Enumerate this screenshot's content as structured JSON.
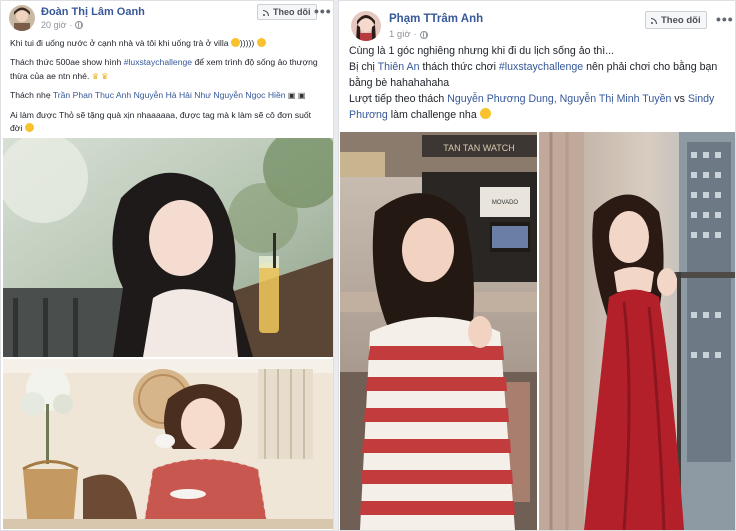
{
  "post1": {
    "author": "Đoàn Thị Lâm Oanh",
    "time": "20 giờ",
    "follow_label": "Theo dõi",
    "more_label": "•••",
    "paragraphs": [
      {
        "pre": "Khi tui đi uống nước ở cạnh nhà và tôi khi uống trà ở villa ",
        "post": ")))))"
      },
      {
        "pre": "Thách thức 500ae show hình ",
        "tag": "#luxstaychallenge",
        "post": " để xem trình độ sống ảo thượng thừa của ae ntn nhé."
      },
      {
        "pre": "Thách nhẹ ",
        "tag": "Trần Phan Thục Anh Nguyễn Hà Hải Như Nguyễn Ngọc Hiền"
      },
      {
        "pre": "Ai làm được Thỏ sẽ tặng quà xịn nhaaaaaa, được tag mà k làm sẽ cô đơn suốt đời"
      }
    ]
  },
  "post2": {
    "author": "Phạm TTrâm Anh",
    "time": "1 giờ",
    "follow_label": "Theo dõi",
    "more_label": "•••",
    "line1": "Cùng là 1 góc nghiêng nhưng khi đi du lịch sống ảo thì...",
    "line2_pre": "Bị chị ",
    "line2_tag1": "Thiên An",
    "line2_mid": " thách thức chơi ",
    "line2_tag2": "#luxstaychallenge",
    "line2_post": " nên phải chơi cho bằng bạn bằng bè hahahahaha",
    "line3_pre": "Lượt tiếp theo thách ",
    "line3_tag1": "Nguyễn Phương Dung, Nguyễn Thị Minh Tuyền",
    "line3_mid": " vs ",
    "line3_tag2": "Sindy Phương",
    "line3_post": " làm challenge nha ",
    "store_sign": "TAN TAN WATCH",
    "brand_sign": "MOVADO"
  },
  "colors": {
    "link": "#365899",
    "author": "#385898",
    "text": "#1d2129",
    "meta": "#90949c",
    "background": "#e9ebee"
  },
  "icons": [
    "globe-icon",
    "rss-follow-icon",
    "more-options-icon",
    "smiley-emoji-icon",
    "crown-emoji-icon",
    "camera-emoji-icon"
  ]
}
